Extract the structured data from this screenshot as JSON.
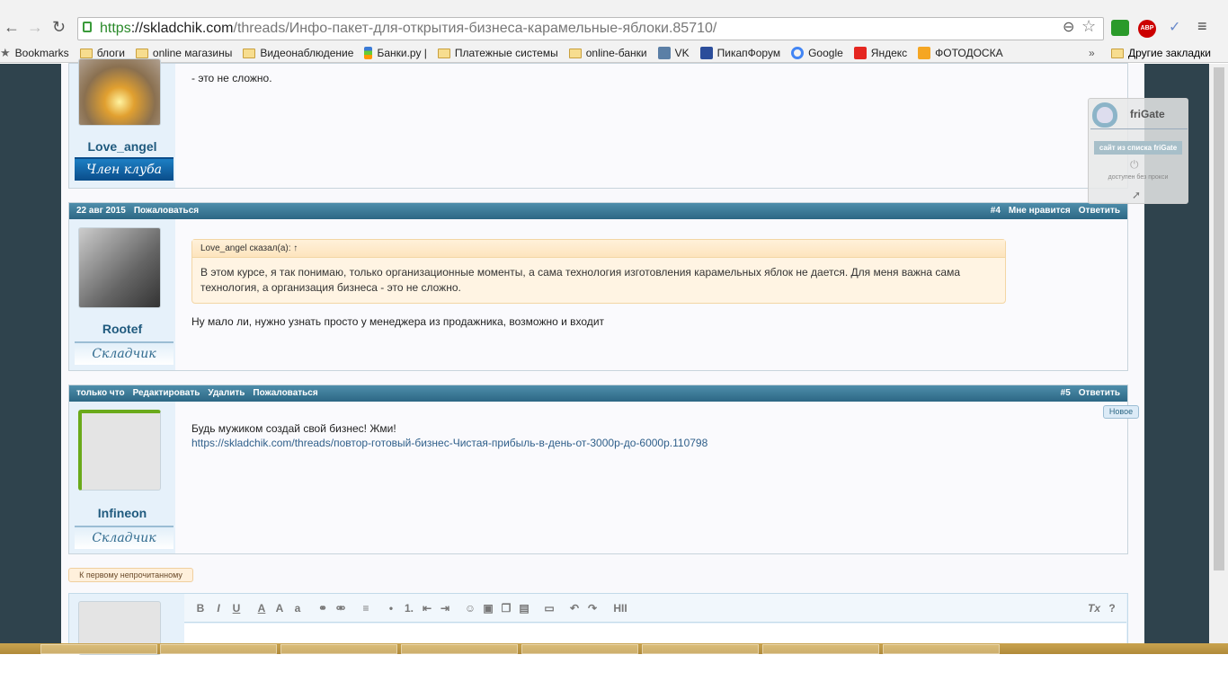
{
  "browser": {
    "url_scheme": "https",
    "url_host": "://skladchik.com",
    "url_path": "/threads/Инфо-пакет-для-открытия-бизнеса-карамельные-яблоки.85710/",
    "bookmarks": [
      {
        "label": "Bookmarks",
        "icon": "star-icon"
      },
      {
        "label": "блоги",
        "icon": "folder-icon"
      },
      {
        "label": "online магазины",
        "icon": "folder-icon"
      },
      {
        "label": "Видеонаблюдение",
        "icon": "folder-icon"
      },
      {
        "label": "Банки.ру |",
        "icon": "banki-icon"
      },
      {
        "label": "Платежные системы",
        "icon": "folder-icon"
      },
      {
        "label": "online-банки",
        "icon": "folder-icon"
      },
      {
        "label": "VK",
        "icon": "vk-icon"
      },
      {
        "label": "ПикапФорум",
        "icon": "pikap-icon"
      },
      {
        "label": "Google",
        "icon": "google-icon"
      },
      {
        "label": "Яндекс",
        "icon": "yandex-icon"
      },
      {
        "label": "ФОТОДОСКА",
        "icon": "fotodoska-icon"
      }
    ],
    "more": "»",
    "other_bookmarks": "Другие закладки",
    "abp": "ABP"
  },
  "posts": [
    {
      "tail_text": "- это не сложно.",
      "username": "Love_angel",
      "rank": "Член клуба"
    },
    {
      "date": "22 авг 2015",
      "report": "Пожаловаться",
      "number": "#4",
      "like": "Мне нравится",
      "reply": "Ответить",
      "username": "Rootef",
      "rank": "Складчик",
      "quote_header": "Love_angel сказал(а): ↑",
      "quote_text": "В этом курсе, я так понимаю, только организационные моменты, а сама технология изготовления карамельных яблок не дается. Для меня важна сама технология, а организация бизнеса - это не сложно.",
      "text": "Ну мало ли, нужно узнать просто у менеджера из продажника, возможно и входит"
    },
    {
      "date": "только что",
      "edit": "Редактировать",
      "delete": "Удалить",
      "report": "Пожаловаться",
      "number": "#5",
      "reply": "Ответить",
      "username": "Infineon",
      "rank": "Складчик",
      "text": "Будь мужиком создай свой бизнес! Жми!",
      "link": "https://skladchik.com/threads/повтор-готовый-бизнес-Чистая-прибыль-в-день-от-3000р-до-6000р.110798",
      "badge": "Новое"
    }
  ],
  "unread_button": "К первому непрочитанному",
  "frigate": {
    "title": "friGate",
    "status": "сайт из списка friGate",
    "note": "доступен без прокси"
  },
  "toolbar": [
    "B",
    "I",
    "U",
    "A",
    "A",
    "a",
    "⚭",
    "⚮",
    "≡",
    "•",
    "1.",
    "⇤",
    "⇥",
    "☺",
    "▣",
    "❐",
    "▤",
    "▭",
    "↶",
    "↷",
    "HII",
    "Tx",
    "?"
  ],
  "colors": {
    "header": "#2c6784",
    "link": "#2f5f8a",
    "sidebar": "#2f434d"
  }
}
